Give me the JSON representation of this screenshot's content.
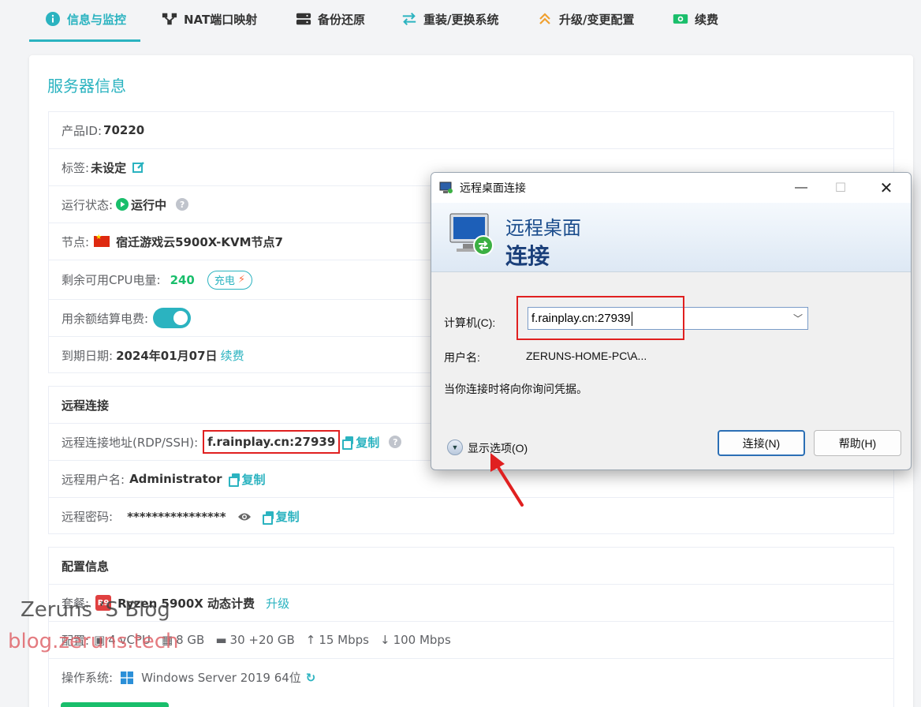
{
  "tabs": [
    {
      "label": "信息与监控",
      "icon": "info-icon",
      "active": true
    },
    {
      "label": "NAT端口映射",
      "icon": "network-icon"
    },
    {
      "label": "备份还原",
      "icon": "server-icon"
    },
    {
      "label": "重装/更换系统",
      "icon": "swap-icon"
    },
    {
      "label": "升级/变更配置",
      "icon": "chevrons-up-icon"
    },
    {
      "label": "续费",
      "icon": "money-icon"
    }
  ],
  "server_info": {
    "title": "服务器信息",
    "product_id_label": "产品ID:",
    "product_id": "70220",
    "tag_label": "标签:",
    "tag_value": "未设定",
    "status_label": "运行状态:",
    "status_value": "运行中",
    "node_label": "节点:",
    "node_value": "宿迁游戏云5900X-KVM节点7",
    "cpu_power_label": "剩余可用CPU电量:",
    "cpu_power_value": "240",
    "charge_label": "充电",
    "balance_label": "用余额结算电费:",
    "expire_label": "到期日期:",
    "expire_value": "2024年01月07日",
    "renew_link": "续费"
  },
  "remote": {
    "title": "远程连接",
    "address_label": "远程连接地址(RDP/SSH):",
    "address_value": "f.rainplay.cn:27939",
    "copy_label": "复制",
    "user_label": "远程用户名:",
    "user_value": "Administrator",
    "password_label": "远程密码:",
    "password_value": "****************"
  },
  "config": {
    "title": "配置信息",
    "plan_label": "套餐:",
    "plan_badge": "R9",
    "plan_value": "Ryzen 5900X 动态计费",
    "upgrade_link": "升级",
    "spec_label": "配置:",
    "cpu": "4 vCPU",
    "ram": "8 GB",
    "disk": "30 +20 GB",
    "up": "15 Mbps",
    "down": "100 Mbps",
    "os_label": "操作系统:",
    "os_value": "Windows Server 2019 64位"
  },
  "watermark": {
    "line1": "Zeruns ’S Blog",
    "line2": "blog.zeruns.tech"
  },
  "rdp_dialog": {
    "window_title": "远程桌面连接",
    "banner_line1": "远程桌面",
    "banner_line2": "连接",
    "computer_label": "计算机(C):",
    "computer_value": "f.rainplay.cn:27939",
    "username_label": "用户名:",
    "username_value": "ZERUNS-HOME-PC\\A...",
    "prompt_text": "当你连接时将向你询问凭据。",
    "show_options": "显示选项(O)",
    "connect_button": "连接(N)",
    "help_button": "帮助(H)"
  },
  "colors": {
    "accent": "#2bb3c0",
    "success": "#19be6b",
    "highlight_red": "#e02020"
  }
}
